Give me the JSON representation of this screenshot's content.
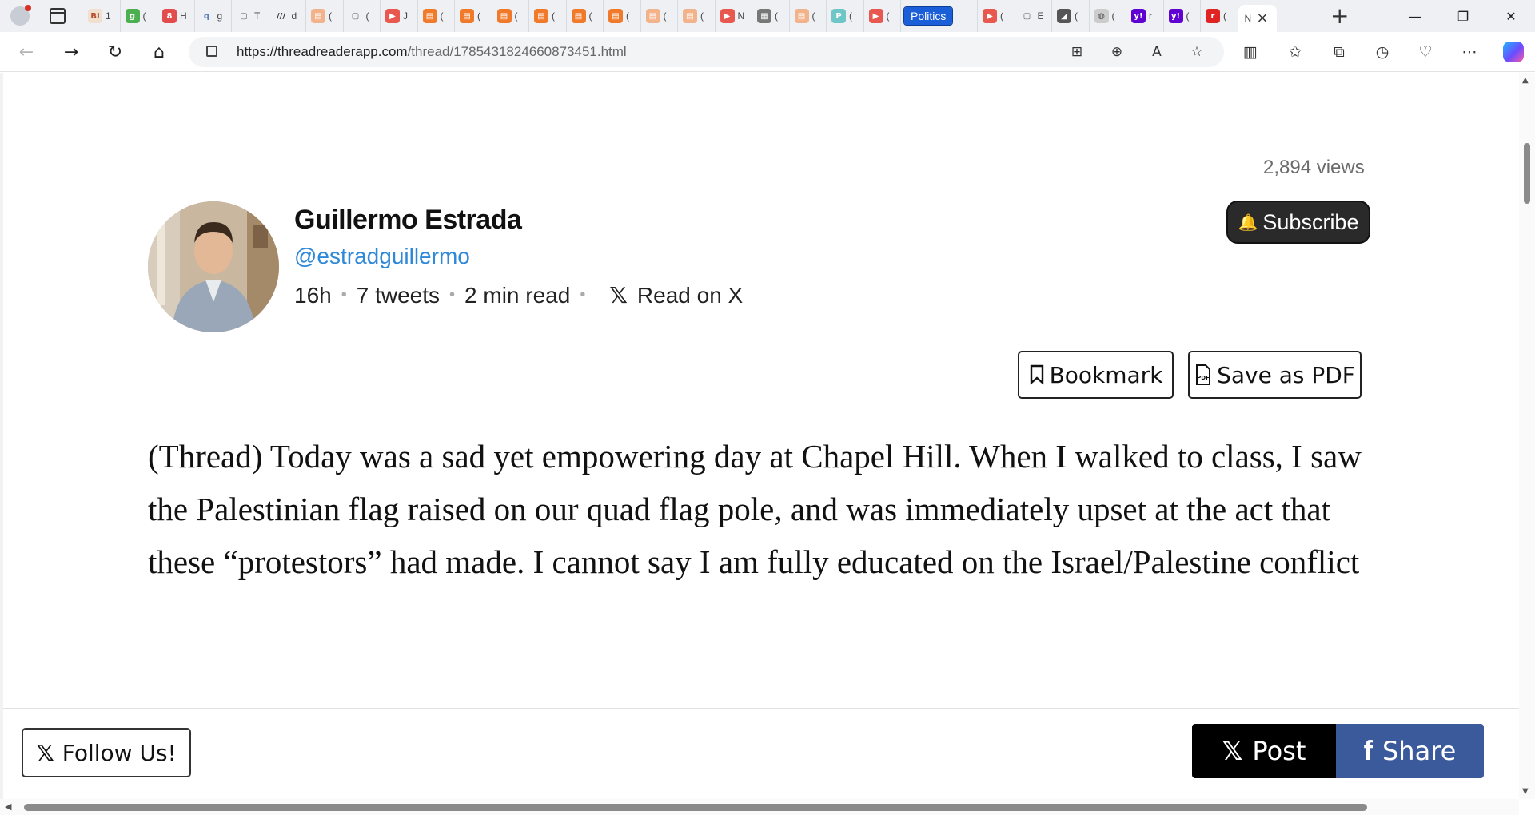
{
  "browser": {
    "tabs_mini": [
      {
        "fav": "BI",
        "color": "#f1e0d0",
        "fg": "#b24a2b",
        "letter": "1"
      },
      {
        "fav": "g",
        "color": "#4caf50",
        "fg": "#ffffff",
        "letter": "("
      },
      {
        "fav": "8",
        "color": "#e34c4c",
        "fg": "#ffffff",
        "letter": "H"
      },
      {
        "fav": "q",
        "color": "#eef0f4",
        "fg": "#5a7dbd",
        "letter": "g"
      },
      {
        "fav": "▢",
        "color": "#eef0f4",
        "fg": "#555555",
        "letter": "T"
      },
      {
        "fav": "///",
        "color": "#eef0f4",
        "fg": "#333333",
        "letter": "d"
      },
      {
        "fav": "▤",
        "color": "#f2b28a",
        "fg": "#ffffff",
        "letter": "("
      },
      {
        "fav": "▢",
        "color": "#eef0f4",
        "fg": "#555555",
        "letter": "("
      },
      {
        "fav": "▶",
        "color": "#e8584e",
        "fg": "#ffffff",
        "letter": "J"
      },
      {
        "fav": "▤",
        "color": "#f07a2a",
        "fg": "#ffffff",
        "letter": "("
      },
      {
        "fav": "▤",
        "color": "#f07a2a",
        "fg": "#ffffff",
        "letter": "("
      },
      {
        "fav": "▤",
        "color": "#f07a2a",
        "fg": "#ffffff",
        "letter": "("
      },
      {
        "fav": "▤",
        "color": "#f07a2a",
        "fg": "#ffffff",
        "letter": "("
      },
      {
        "fav": "▤",
        "color": "#f07a2a",
        "fg": "#ffffff",
        "letter": "("
      },
      {
        "fav": "▤",
        "color": "#f07a2a",
        "fg": "#ffffff",
        "letter": "("
      },
      {
        "fav": "▤",
        "color": "#f2b28a",
        "fg": "#ffffff",
        "letter": "("
      },
      {
        "fav": "▤",
        "color": "#f2b28a",
        "fg": "#ffffff",
        "letter": "("
      },
      {
        "fav": "▶",
        "color": "#e8584e",
        "fg": "#ffffff",
        "letter": "N"
      },
      {
        "fav": "▦",
        "color": "#777777",
        "fg": "#ffffff",
        "letter": "("
      },
      {
        "fav": "▤",
        "color": "#f2b28a",
        "fg": "#ffffff",
        "letter": "("
      },
      {
        "fav": "P",
        "color": "#6fc6c6",
        "fg": "#ffffff",
        "letter": "("
      },
      {
        "fav": "▶",
        "color": "#e8584e",
        "fg": "#ffffff",
        "letter": "("
      }
    ],
    "politics_tab": "Politics",
    "tabs_after": [
      {
        "fav": "▶",
        "color": "#e8584e",
        "fg": "#ffffff",
        "letter": "("
      },
      {
        "fav": "▢",
        "color": "#eef0f4",
        "fg": "#555555",
        "letter": "E"
      },
      {
        "fav": "◢",
        "color": "#555555",
        "fg": "#ffffff",
        "letter": "("
      },
      {
        "fav": "◍",
        "color": "#cccccc",
        "fg": "#444444",
        "letter": "("
      },
      {
        "fav": "y!",
        "color": "#5f01d1",
        "fg": "#ffffff",
        "letter": "r"
      },
      {
        "fav": "y!",
        "color": "#5f01d1",
        "fg": "#ffffff",
        "letter": "("
      },
      {
        "fav": "r",
        "color": "#e02424",
        "fg": "#ffffff",
        "letter": "("
      }
    ],
    "active_tab": {
      "letter": "N",
      "close": "×"
    },
    "new_tab": "+",
    "window": {
      "minimize": "—",
      "restore": "❐",
      "close": "✕"
    },
    "nav": {
      "back": "←",
      "forward": "→",
      "reload": "↻",
      "home": "⌂"
    },
    "url_host": "https://threadreaderapp.com",
    "url_path": "/thread/1785431824660873451.html",
    "omnibox_icons": [
      "⊞",
      "⊕",
      "A",
      "☆"
    ],
    "toolbar_icons": [
      "▥",
      "✩",
      "⧉",
      "◷",
      "♡",
      "⋯"
    ]
  },
  "page": {
    "views": "2,894 views",
    "author": {
      "name": "Guillermo Estrada",
      "handle": "@estradguillermo"
    },
    "meta": {
      "age": "16h",
      "tweets": "7 tweets",
      "read_time": "2 min read",
      "x_logo": "𝕏",
      "read_on_x": "Read on X",
      "separator": "•"
    },
    "subscribe": {
      "icon": "🔔",
      "label": "Subscribe"
    },
    "bookmark": {
      "icon": "⊓",
      "label": "Bookmark"
    },
    "save_pdf": {
      "icon": "PDF",
      "label": "Save as PDF"
    },
    "thread_text": "(Thread) Today was a sad yet empowering day at Chapel Hill. When I walked to class, I saw the Palestinian flag raised on our quad flag pole, and was immediately upset at the act that these “protestors” had made. I cannot say I am fully educated on the Israel/Palestine conflict",
    "follow": {
      "icon": "𝕏",
      "label": "Follow Us!"
    },
    "post": {
      "icon": "𝕏",
      "label": "Post"
    },
    "share": {
      "icon": "f",
      "label": "Share"
    }
  },
  "scrollbars": {
    "up": "▲",
    "down": "▼",
    "left": "◀"
  },
  "colors": {
    "handle": "#2f88d8",
    "subscribe_bg": "#2a2a2a",
    "share_bg": "#3b5a9b",
    "post_bg": "#000000"
  }
}
